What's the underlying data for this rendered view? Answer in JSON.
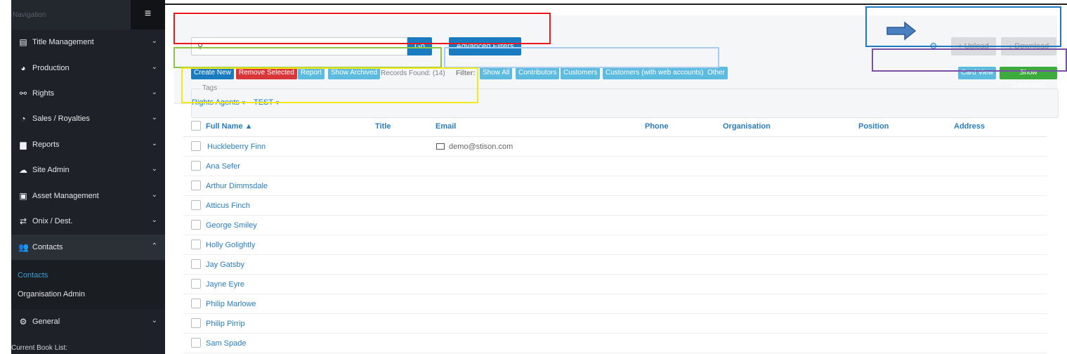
{
  "sidebar": {
    "header_label": "Navigation",
    "menu_icon": "hamburger-icon",
    "items": [
      {
        "label": "Title Management",
        "icon": "book-icon"
      },
      {
        "label": "Production",
        "icon": "palette-icon"
      },
      {
        "label": "Rights",
        "icon": "link-icon"
      },
      {
        "label": "Sales / Royalties",
        "icon": "pie-chart-icon"
      },
      {
        "label": "Reports",
        "icon": "document-icon"
      },
      {
        "label": "Site Admin",
        "icon": "cloud-icon"
      },
      {
        "label": "Asset Management",
        "icon": "image-file-icon"
      },
      {
        "label": "Onix / Dest.",
        "icon": "transfer-arrows-icon"
      },
      {
        "label": "Contacts",
        "icon": "users-icon"
      },
      {
        "label": "General",
        "icon": "gears-icon"
      }
    ],
    "sub_items": [
      "Contacts",
      "Organisation Admin"
    ],
    "footer_label": "Current Book List:"
  },
  "toolbar": {
    "search_placeholder": "",
    "go_label": "Go",
    "advanced_filters_label": "Advanced Filters",
    "upload_label": "↑ Upload",
    "download_label": "↓ Download"
  },
  "actions": {
    "create_new": "Create New",
    "remove_selected": "Remove Selected",
    "report": "Report",
    "show_archived": "Show Archived",
    "records_found": "Records Found: (14)"
  },
  "filters": {
    "label": "Filter:",
    "options": [
      "Show All",
      "Contributors",
      "Customers",
      "Customers (with web accounts)",
      "Other"
    ]
  },
  "view": {
    "card_view": "Card View",
    "show_duplicates": "Show Duplicates"
  },
  "tags": {
    "title": "Tags",
    "dropdowns": [
      "Rights Agents",
      "TEST"
    ]
  },
  "table": {
    "columns": [
      "Full Name ▲",
      "Title",
      "Email",
      "Phone",
      "Organisation",
      "Position",
      "Address"
    ],
    "rows": [
      {
        "name": "Huckleberry Finn",
        "email": "demo@stison.com"
      },
      {
        "name": "Ana Sefer",
        "email": ""
      },
      {
        "name": "Arthur Dimmsdale",
        "email": ""
      },
      {
        "name": "Atticus Finch",
        "email": ""
      },
      {
        "name": "George Smiley",
        "email": ""
      },
      {
        "name": "Holly Golightly",
        "email": ""
      },
      {
        "name": "Jay Gatsby",
        "email": ""
      },
      {
        "name": "Jayne Eyre",
        "email": ""
      },
      {
        "name": "Philip Marlowe",
        "email": ""
      },
      {
        "name": "Philip Pirrip",
        "email": ""
      },
      {
        "name": "Sam Spade",
        "email": ""
      }
    ]
  },
  "colors": {
    "primary": "#1b7bc0",
    "info": "#5dbbe0",
    "danger": "#d9363a",
    "success": "#3caa3c",
    "sidebar_bg": "#1e2228",
    "link": "#2b7cbc"
  }
}
